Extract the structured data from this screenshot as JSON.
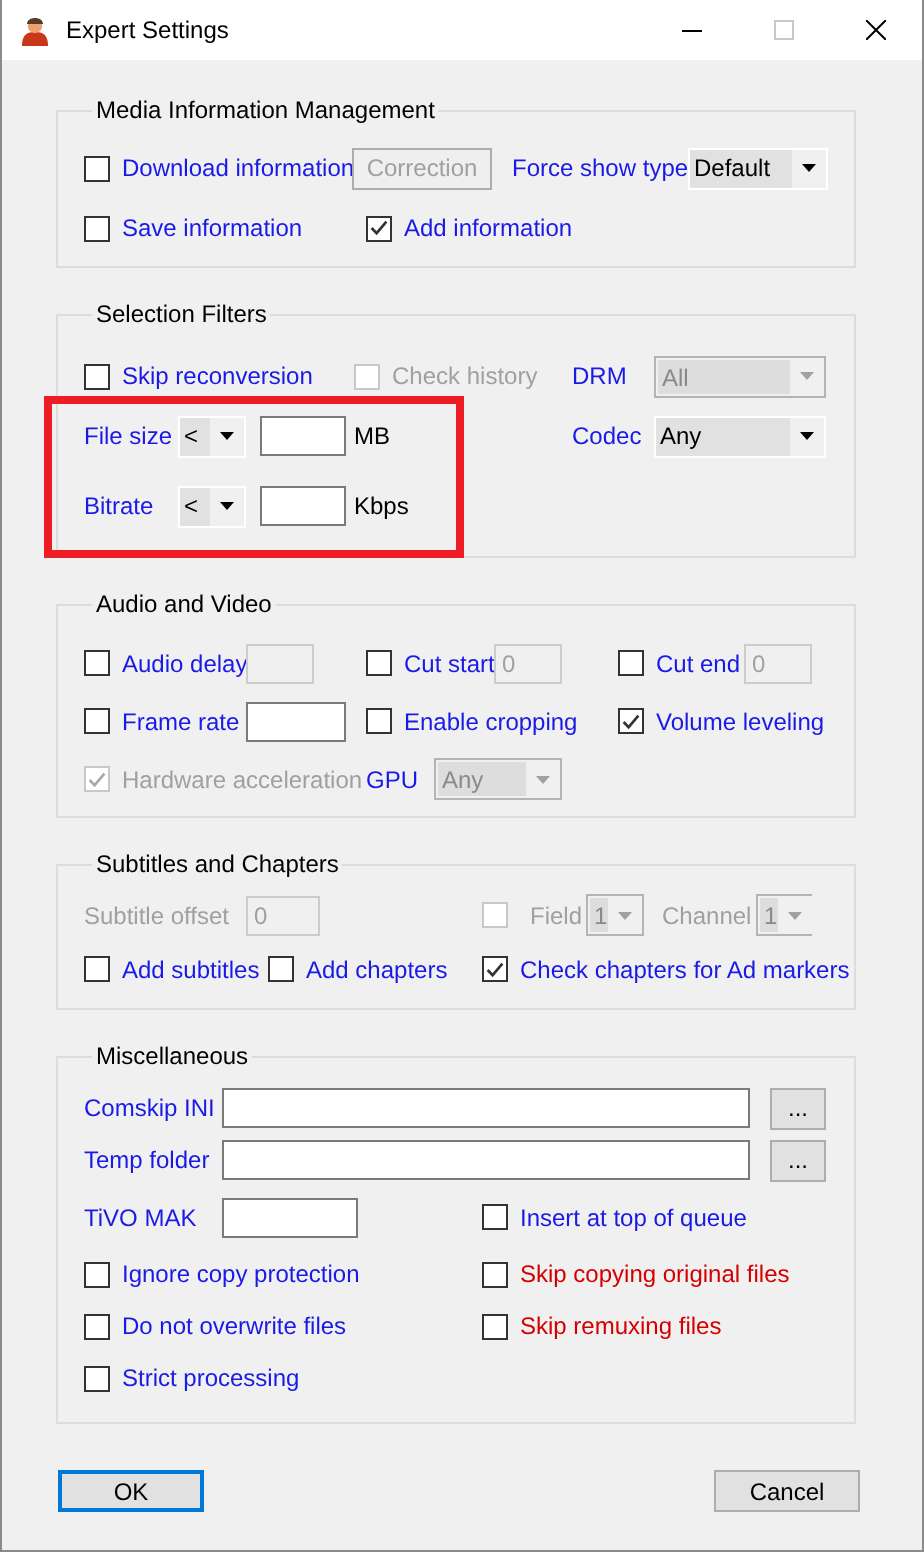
{
  "window": {
    "title": "Expert Settings"
  },
  "sections": [
    {
      "title": "Media Information Management",
      "highlighted": false,
      "rows": [
        [
          {
            "kind": "checkbox",
            "label": "Download information",
            "checked": false,
            "disabled": false
          },
          {
            "kind": "button",
            "label": "Correction",
            "disabled": true
          },
          {
            "kind": "label",
            "text": "Force show type",
            "disabled": false
          },
          {
            "kind": "combo",
            "value": "Default",
            "disabled": false
          }
        ],
        [
          {
            "kind": "checkbox",
            "label": "Save information",
            "checked": false,
            "disabled": false
          },
          {
            "kind": "checkbox",
            "label": "Add information",
            "checked": true,
            "disabled": false
          }
        ]
      ]
    },
    {
      "title": "Selection Filters",
      "highlighted": true,
      "rows": [
        [
          {
            "kind": "checkbox",
            "label": "Skip reconversion",
            "checked": false,
            "disabled": false
          },
          "",
          "",
          {
            "kind": "checkbox",
            "label": "Check history",
            "checked": false,
            "disabled": true
          },
          {
            "kind": "label",
            "text": "DRM",
            "disabled": false
          },
          {
            "kind": "combo",
            "value": "All",
            "disabled": true
          }
        ],
        [
          {
            "kind": "label",
            "text": "File size",
            "disabled": false
          },
          {
            "kind": "combo",
            "value": "<",
            "disabled": false
          },
          {
            "kind": "field",
            "disabled": false
          },
          {
            "kind": "unit",
            "text": "MB"
          },
          {
            "kind": "label",
            "text": "Codec",
            "disabled": false
          },
          {
            "kind": "combo",
            "value": "Any",
            "disabled": false
          }
        ],
        [
          {
            "kind": "label",
            "text": "Bitrate",
            "disabled": false
          },
          {
            "kind": "combo",
            "value": "<",
            "disabled": false
          },
          {
            "kind": "field",
            "disabled": false
          },
          {
            "kind": "unit",
            "text": "Kbps"
          }
        ]
      ]
    },
    {
      "title": "Audio and Video",
      "highlighted": false,
      "rows": [
        [
          {
            "kind": "checkbox",
            "label": "Audio delay",
            "checked": false,
            "disabled": false
          },
          {
            "kind": "field",
            "disabled": true
          },
          {
            "kind": "checkbox",
            "label": "Cut start",
            "checked": false,
            "disabled": false
          },
          {
            "kind": "field",
            "value": "0",
            "disabled": true
          },
          {
            "kind": "checkbox",
            "label": "Cut end",
            "checked": false,
            "disabled": false
          },
          {
            "kind": "field",
            "value": "0",
            "disabled": true
          }
        ],
        [
          {
            "kind": "checkbox",
            "label": "Frame rate",
            "checked": false,
            "disabled": false
          },
          {
            "kind": "field",
            "disabled": false
          },
          {
            "kind": "checkbox",
            "label": "Enable cropping",
            "checked": false,
            "disabled": false
          },
          "",
          {
            "kind": "checkbox",
            "label": "Volume leveling",
            "checked": true,
            "disabled": false
          }
        ],
        [
          {
            "kind": "checkbox",
            "label": "Hardware acceleration",
            "checked": true,
            "disabled": true
          },
          {
            "kind": "label",
            "text": "GPU",
            "disabled": false
          },
          {
            "kind": "combo",
            "value": "Any",
            "disabled": true
          }
        ]
      ]
    },
    {
      "title": "Subtitles and Chapters",
      "highlighted": false,
      "rows": [
        [
          {
            "kind": "label",
            "text": "Subtitle offset",
            "disabled": true
          },
          {
            "kind": "field",
            "value": "0",
            "disabled": true
          },
          {
            "kind": "checkbox",
            "checked": false,
            "disabled": true
          },
          {
            "kind": "label",
            "text": "Field",
            "disabled": true
          },
          {
            "kind": "combo",
            "value": "1",
            "disabled": true
          },
          {
            "kind": "label",
            "text": "Channel",
            "disabled": true
          },
          {
            "kind": "combo",
            "value": "1",
            "disabled": true
          }
        ],
        [
          {
            "kind": "checkbox",
            "label": "Add subtitles",
            "checked": false,
            "disabled": false
          },
          {
            "kind": "checkbox",
            "label": "Add chapters",
            "checked": false,
            "disabled": false
          },
          {
            "kind": "checkbox",
            "label": "Check chapters for Ad markers",
            "checked": true,
            "disabled": false
          }
        ]
      ]
    },
    {
      "title": "Miscellaneous",
      "highlighted": false,
      "rows": [
        [
          {
            "kind": "label",
            "text": "Comskip INI",
            "disabled": false
          },
          {
            "kind": "field",
            "disabled": false
          },
          {
            "kind": "button",
            "label": "...",
            "disabled": false
          }
        ],
        [
          {
            "kind": "label",
            "text": "Temp folder",
            "disabled": false
          },
          {
            "kind": "field",
            "disabled": false
          },
          {
            "kind": "button",
            "label": "...",
            "disabled": false
          }
        ],
        [
          {
            "kind": "label",
            "text": "TiVO MAK",
            "disabled": false
          },
          {
            "kind": "field",
            "disabled": false
          },
          {
            "kind": "checkbox",
            "label": "Insert at top of queue",
            "checked": false,
            "disabled": false
          }
        ],
        [
          {
            "kind": "checkbox",
            "label": "Ignore copy protection",
            "checked": false,
            "disabled": false
          },
          "",
          {
            "kind": "caution_checkbox",
            "label": "Skip copying original files",
            "checked": false,
            "disabled": false
          }
        ],
        [
          {
            "kind": "checkbox",
            "label": "Do not overwrite files",
            "checked": false,
            "disabled": false
          },
          "",
          {
            "kind": "caution_checkbox",
            "label": "Skip remuxing files",
            "checked": false,
            "disabled": false
          }
        ],
        [
          {
            "kind": "checkbox",
            "label": "Strict processing",
            "checked": false,
            "disabled": false
          }
        ]
      ]
    }
  ],
  "buttons": [
    {
      "label": "OK",
      "focused": true
    },
    {
      "label": "Cancel",
      "focused": false
    }
  ]
}
